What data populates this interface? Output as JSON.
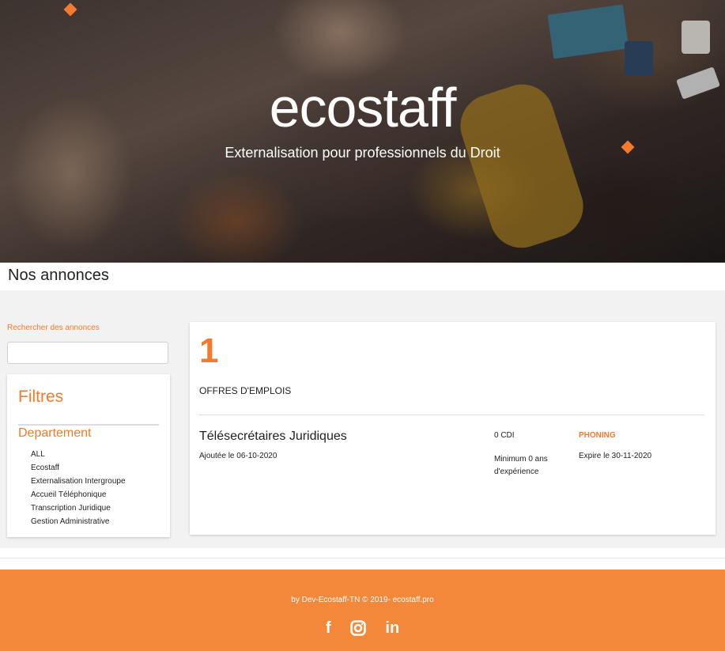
{
  "hero": {
    "brand": "ecostaff",
    "tagline": "Externalisation pour professionnels du Droit"
  },
  "page": {
    "title": "Nos annonces"
  },
  "search": {
    "label": "Rechercher des annonces",
    "value": "",
    "placeholder": ""
  },
  "filters": {
    "title": "Filtres",
    "department_heading": "Departement",
    "departments": [
      "ALL",
      "Ecostaff",
      "Externalisation Intergroupe",
      "Accueil Téléphonique",
      "Transcription Juridique",
      "Gestion Administrative"
    ]
  },
  "listings": {
    "count": "1",
    "label": "OFFRES D'EMPLOIS",
    "jobs": [
      {
        "title": "Télésecrétaires Juridiques",
        "added": "Ajoutée le 06-10-2020",
        "contract": "0 CDI",
        "experience": "Minimum 0 ans d'expérience",
        "category": "PHONING",
        "expires": "Expire le 30-11-2020"
      }
    ]
  },
  "footer": {
    "copyright": "by Dev-Ecostaff-TN © 2019- ecostaff.pro",
    "facebook": "f",
    "linkedin": "in",
    "icons": [
      "facebook-icon",
      "instagram-icon",
      "linkedin-icon"
    ]
  },
  "colors": {
    "accent": "#f47a2d",
    "footer": "#f4883a",
    "band": "#f2f2f2"
  }
}
